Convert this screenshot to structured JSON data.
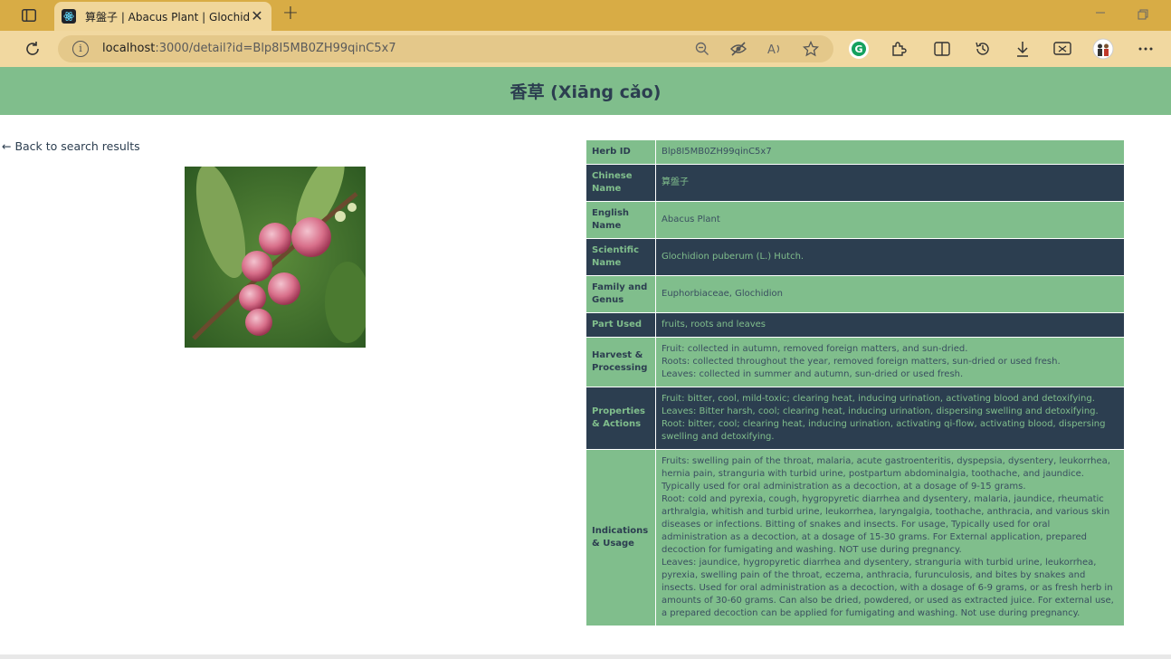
{
  "browser": {
    "tab_title": "算盤子 | Abacus Plant | Glochidion puberum",
    "new_tab_symbol": "+",
    "close_symbol": "✕",
    "url_host": "localhost",
    "url_rest": ":3000/detail?id=Blp8I5MB0ZH99qinC5x7"
  },
  "page": {
    "title": "香草 (Xiāng cǎo)",
    "back_link": "← Back to search results",
    "image_alt": "Abacus Plant"
  },
  "details": {
    "herb_id": {
      "label": "Herb ID",
      "value": "Blp8I5MB0ZH99qinC5x7"
    },
    "chinese_name": {
      "label": "Chinese Name",
      "value": "算盤子"
    },
    "english_name": {
      "label": "English Name",
      "value": "Abacus Plant"
    },
    "scientific_name": {
      "label": "Scientific Name",
      "value": "Glochidion puberum (L.) Hutch."
    },
    "family_genus": {
      "label": "Family and Genus",
      "value": "Euphorbiaceae, Glochidion"
    },
    "part_used": {
      "label": "Part Used",
      "value": "fruits, roots and leaves"
    },
    "harvest": {
      "label": "Harvest & Processing",
      "lines": [
        "Fruit: collected in autumn, removed foreign matters, and sun-dried.",
        "Roots: collected throughout the year, removed foreign matters, sun-dried or used fresh.",
        "Leaves: collected in summer and autumn, sun-dried or used fresh."
      ]
    },
    "properties": {
      "label": "Properties & Actions",
      "lines": [
        "Fruit: bitter, cool, mild-toxic; clearing heat, inducing urination, activating blood and detoxifying.",
        "Leaves: Bitter harsh, cool; clearing heat, inducing urination, dispersing swelling and detoxifying.",
        "Root: bitter, cool; clearing heat, inducing urination, activating qi-flow, activating blood, dispersing swelling and detoxifying."
      ]
    },
    "indications": {
      "label": "Indications & Usage",
      "lines": [
        "Fruits: swelling pain of the throat, malaria, acute gastroenteritis, dyspepsia, dysentery, leukorrhea, hernia pain, stranguria with turbid urine, postpartum abdominalgia, toothache, and jaundice. Typically used for oral administration as a decoction, at a dosage of 9-15 grams.",
        "Root: cold and pyrexia, cough, hygropyretic diarrhea and dysentery, malaria, jaundice, rheumatic arthralgia, whitish and turbid urine, leukorrhea, laryngalgia, toothache, anthracia, and various skin diseases or infections. Bitting of snakes and insects. For usage, Typically used for oral administration as a decoction, at a dosage of 15-30 grams. For External application, prepared decoction for fumigating and washing. NOT use during pregnancy.",
        "Leaves: jaundice, hygropyretic diarrhea and dysentery, stranguria with turbid urine, leukorrhea, pyrexia, swelling pain of the throat, eczema, anthracia, furunculosis, and bites by snakes and insects. Used for oral administration as a decoction, with a dosage of 6-9 grams, or as fresh herb in amounts of 30-60 grams. Can also be dried, powdered, or used as extracted juice. For external use, a prepared decoction can be applied for fumigating and washing. Not use during pregnancy."
      ]
    }
  },
  "colors": {
    "chrome_titlebar": "#d8ac45",
    "chrome_toolbar": "#f1d8a0",
    "header_green": "#80be8c",
    "dark_navy": "#2c3e50"
  },
  "icons": [
    "sidebar-icon",
    "react-favicon",
    "refresh-icon",
    "info-icon",
    "zoom-out-icon",
    "tracking-icon",
    "read-aloud-icon",
    "favorite-star-icon",
    "grammarly-icon",
    "extensions-icon",
    "split-screen-icon",
    "history-icon",
    "download-icon",
    "screenshot-icon",
    "profile-icon",
    "more-icon"
  ]
}
